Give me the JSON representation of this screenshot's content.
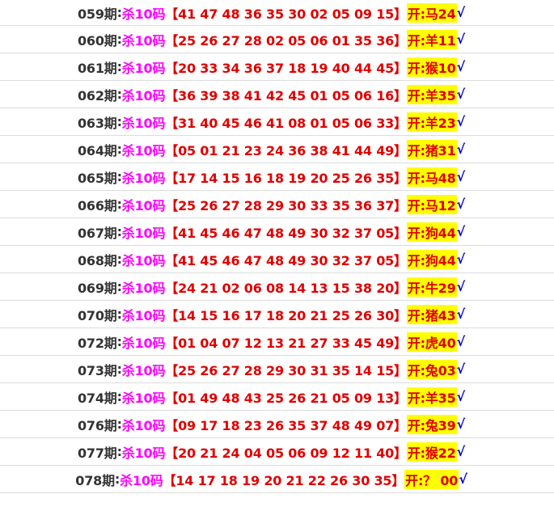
{
  "rows": [
    {
      "period": "059期",
      "kill": "杀10码",
      "nums": "【41 47 48 36 35 30 02 05 09 15】",
      "result": "开:马24",
      "check": "√"
    },
    {
      "period": "060期",
      "kill": "杀10码",
      "nums": "【25 26 27 28 02 05 06 01 35 36】",
      "result": "开:羊11",
      "check": "√"
    },
    {
      "period": "061期",
      "kill": "杀10码",
      "nums": "【20 33 34 36 37 18 19 40 44 45】",
      "result": "开:猴10",
      "check": "√"
    },
    {
      "period": "062期",
      "kill": "杀10码",
      "nums": "【36 39 38 41 42 45 01 05 06 16】",
      "result": "开:羊35",
      "check": "√"
    },
    {
      "period": "063期",
      "kill": "杀10码",
      "nums": "【31 40 45 46 41 08 01 05 06 33】",
      "result": "开:羊23",
      "check": "√"
    },
    {
      "period": "064期",
      "kill": "杀10码",
      "nums": "【05 01 21 23 24 36 38 41 44 49】",
      "result": "开:猪31",
      "check": "√"
    },
    {
      "period": "065期",
      "kill": "杀10码",
      "nums": "【17 14 15 16 18 19 20 25 26 35】",
      "result": "开:马48",
      "check": "√"
    },
    {
      "period": "066期",
      "kill": "杀10码",
      "nums": "【25 26 27 28 29 30 33 35 36 37】",
      "result": "开:马12",
      "check": "√"
    },
    {
      "period": "067期",
      "kill": "杀10码",
      "nums": "【41 45 46 47 48 49 30 32 37 05】",
      "result": "开:狗44",
      "check": "√"
    },
    {
      "period": "068期",
      "kill": "杀10码",
      "nums": "【41 45 46 47 48 49 30 32 37 05】",
      "result": "开:狗44",
      "check": "√"
    },
    {
      "period": "069期",
      "kill": "杀10码",
      "nums": "【24 21 02 06 08 14 13 15 38 20】",
      "result": "开:牛29",
      "check": "√"
    },
    {
      "period": "070期",
      "kill": "杀10码",
      "nums": "【14 15 16 17 18 20 21 25 26 30】",
      "result": "开:猪43",
      "check": "√"
    },
    {
      "period": "072期",
      "kill": "杀10码",
      "nums": "【01 04 07 12 13 21 27 33 45 49】",
      "result": "开:虎40",
      "check": "√"
    },
    {
      "period": "073期",
      "kill": "杀10码",
      "nums": "【25 26 27 28 29 30 31 35 14 15】",
      "result": "开:兔03",
      "check": "√"
    },
    {
      "period": "074期",
      "kill": "杀10码",
      "nums": "【01 49 48 43 25 26 21 05 09 13】",
      "result": "开:羊35",
      "check": "√"
    },
    {
      "period": "076期",
      "kill": "杀10码",
      "nums": "【09 17 18 23 26 35 37 48 49 07】",
      "result": "开:兔39",
      "check": "√"
    },
    {
      "period": "077期",
      "kill": "杀10码",
      "nums": "【20 21 24 04 05 06 09 12 11 40】",
      "result": "开:猴22",
      "check": "√"
    },
    {
      "period": "078期",
      "kill": "杀10码",
      "nums": "【14 17 18 19 20 21 22 26 30 35】",
      "result": "开:？ 00",
      "check": "√"
    }
  ]
}
